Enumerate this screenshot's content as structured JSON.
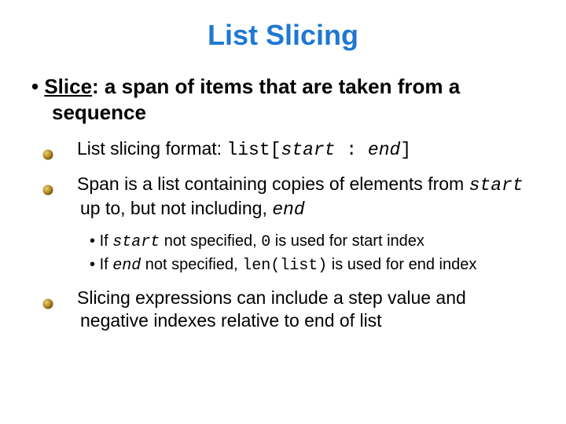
{
  "title": "List Slicing",
  "main_bullet": {
    "term": "Slice",
    "rest": ": a span of items that are taken from a sequence"
  },
  "sub": {
    "a_pre": "List slicing format: ",
    "a_code1": "list[",
    "a_code2": "start",
    "a_code3": " : ",
    "a_code4": "end",
    "a_code5": "]",
    "b_1": "Span is a list containing copies of elements from ",
    "b_start": "start",
    "b_2": " up to, but not including, ",
    "b_end": "end",
    "c": "Slicing expressions can include a step value and negative indexes relative to end of list"
  },
  "subsub": {
    "a_1": "If ",
    "a_start": "start",
    "a_2": " not specified, ",
    "a_zero": "0",
    "a_3": " is used for start index",
    "b_1": "If ",
    "b_end": "end",
    "b_2": " not specified, ",
    "b_len": "len(list)",
    "b_3": " is used for end index"
  }
}
